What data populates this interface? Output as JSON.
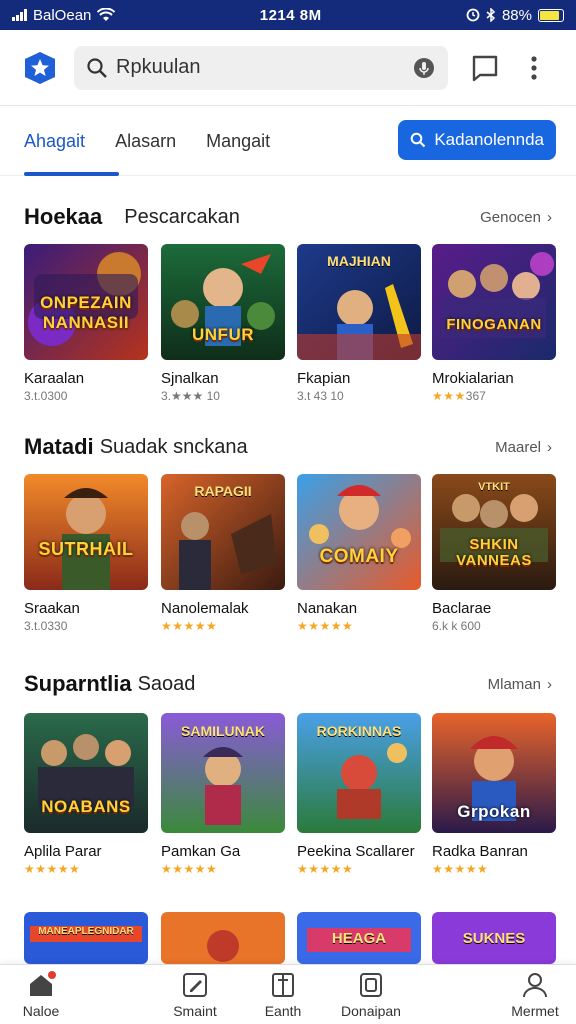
{
  "status_bar": {
    "carrier": "BalOean",
    "time": "1214 8M",
    "battery": "88%",
    "battery_level": 0.88
  },
  "app_bar": {
    "search_placeholder": "Rpkuulan",
    "icons": [
      "app-logo-star",
      "search-icon",
      "mic-icon",
      "chat-icon",
      "more-vert-icon"
    ]
  },
  "tabs": {
    "items": [
      "Ahagait",
      "Alasarn",
      "Mangait"
    ],
    "active_index": 0,
    "button_label": "Kadanolennda"
  },
  "sections": [
    {
      "title": "Hoekaa",
      "subtitle": "Pescarcakan",
      "link": "Genocen",
      "cards": [
        {
          "name": "Karaalan",
          "meta": "3.t.0300",
          "rating": "",
          "tile_text": "ONPEZAIN NANNASII",
          "top_text": ""
        },
        {
          "name": "Sjnalkan",
          "meta": "3.★★★ 10",
          "rating": "",
          "tile_text": "UNFUR",
          "top_text": ""
        },
        {
          "name": "Fkapian",
          "meta": "3.t 43 10",
          "rating": "",
          "tile_text": "",
          "top_text": "MAJHIAN"
        },
        {
          "name": "Mrokialarian",
          "meta": "367",
          "rating": "★★★",
          "tile_text": "FINOGANAN",
          "top_text": ""
        }
      ]
    },
    {
      "title": "Matadi",
      "subtitle": "Suadak snckana",
      "link": "Maarel",
      "cards": [
        {
          "name": "Sraakan",
          "meta": "3.t.0330",
          "rating": "",
          "tile_text": "SUTRHAIL",
          "top_text": ""
        },
        {
          "name": "Nanolemalak",
          "meta": "",
          "rating": "★★★★★",
          "tile_text": "",
          "top_text": "RAPAGII"
        },
        {
          "name": "Nanakan",
          "meta": "",
          "rating": "★★★★★",
          "tile_text": "COMAIY",
          "top_text": ""
        },
        {
          "name": "Baclarae",
          "meta": "6.k k 600",
          "rating": "",
          "tile_text": "SHKIN VANNEAS",
          "top_text": "VTKIT"
        }
      ]
    },
    {
      "title": "Suparntlia",
      "subtitle": "Saoad",
      "link": "Mlaman",
      "cards": [
        {
          "name": "Aplila Parar",
          "meta": "",
          "rating": "★★★★★",
          "tile_text": "NOABANS",
          "top_text": ""
        },
        {
          "name": "Pamkan Ga",
          "meta": "",
          "rating": "★★★★★",
          "tile_text": "",
          "top_text": "SAMILUNAK"
        },
        {
          "name": "Peekina Scallarer",
          "meta": "",
          "rating": "★★★★★",
          "tile_text": "",
          "top_text": "RORKINNAS"
        },
        {
          "name": "Radka Banran",
          "meta": "",
          "rating": "★★★★★",
          "tile_text": "Grpokan",
          "top_text": ""
        }
      ]
    }
  ],
  "partial_row": {
    "tiles": [
      "MANEAPLEGNIDAR",
      "",
      "HEAGA",
      "SUKNES"
    ]
  },
  "bottom_nav": {
    "items": [
      "Naloe",
      "Smaint",
      "Eanth",
      "Donaipan",
      "Mermet"
    ],
    "active_index": 0
  },
  "colors": {
    "accent": "#1967e0",
    "status_bar": "#142a7a",
    "star": "#f5a623"
  }
}
